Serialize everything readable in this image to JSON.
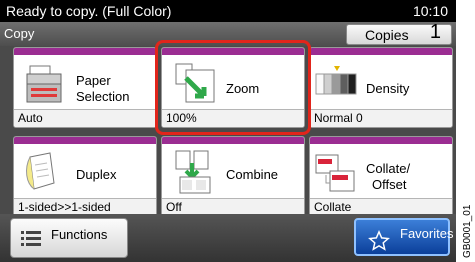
{
  "status": {
    "message": "Ready to copy. (Full Color)",
    "time": "10:10"
  },
  "header": {
    "title": "Copy",
    "copies_label": "Copies",
    "copies_value": "1"
  },
  "tiles": [
    {
      "label_line1": "Paper",
      "label_line2": "Selection",
      "value": "Auto",
      "icon": "paper-tray-icon"
    },
    {
      "label_line1": "Zoom",
      "label_line2": "",
      "value": "100%",
      "icon": "zoom-icon"
    },
    {
      "label_line1": "Density",
      "label_line2": "",
      "value": "Normal 0",
      "icon": "density-icon"
    },
    {
      "label_line1": "Duplex",
      "label_line2": "",
      "value": "1-sided>>1-sided",
      "icon": "duplex-icon"
    },
    {
      "label_line1": "Combine",
      "label_line2": "",
      "value": "Off",
      "icon": "combine-icon"
    },
    {
      "label_line1": "Collate/",
      "label_line2": "Offset",
      "value": "Collate",
      "icon": "collate-icon"
    }
  ],
  "footer": {
    "functions_label": "Functions",
    "favorites_label": "Favorites"
  },
  "figure_code": "GB0001_01",
  "colors": {
    "tile_stripe": "#9b2d92",
    "highlight": "#e1251b",
    "favorites_bg": "#1f5fbf"
  }
}
